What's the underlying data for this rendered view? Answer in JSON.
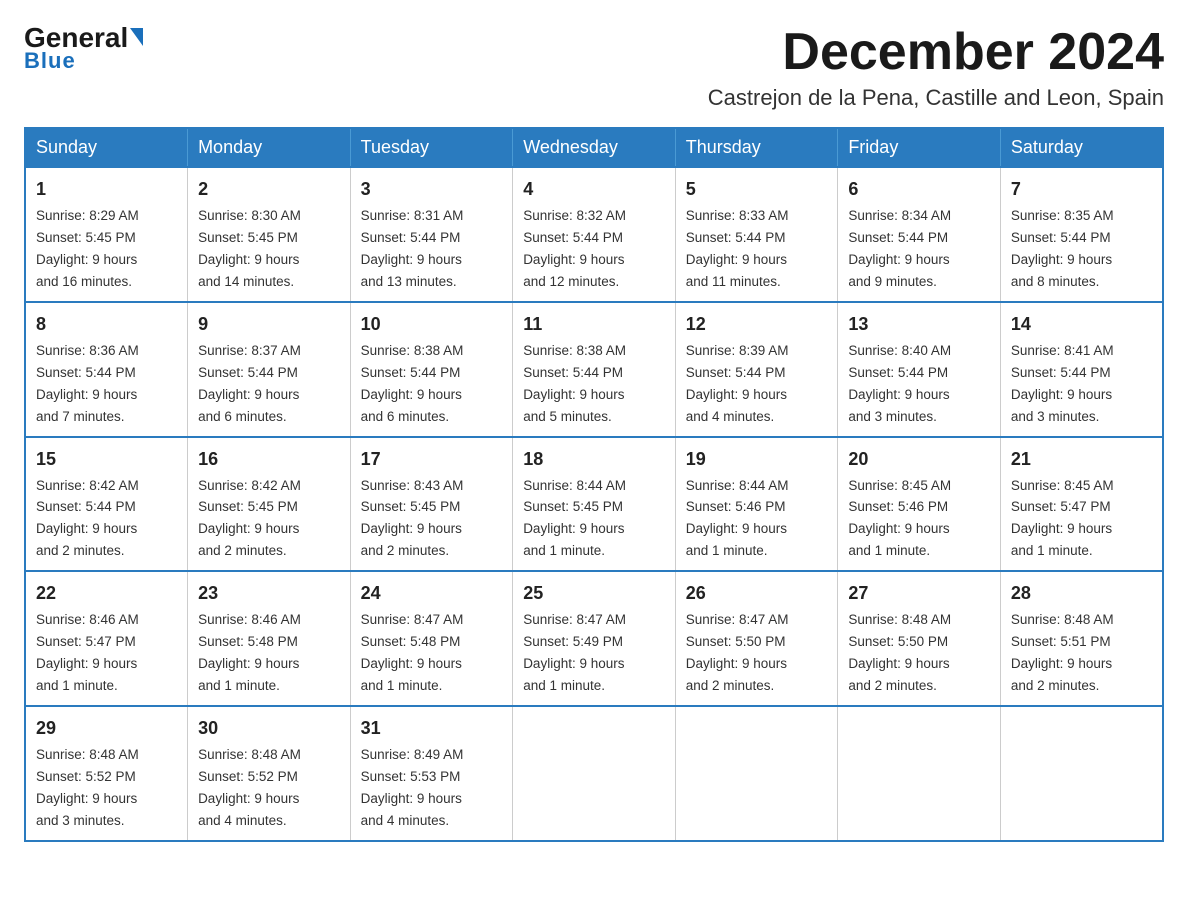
{
  "logo": {
    "general": "General",
    "arrow": "▶",
    "blue": "Blue"
  },
  "header": {
    "month": "December 2024",
    "location": "Castrejon de la Pena, Castille and Leon, Spain"
  },
  "days_of_week": [
    "Sunday",
    "Monday",
    "Tuesday",
    "Wednesday",
    "Thursday",
    "Friday",
    "Saturday"
  ],
  "weeks": [
    [
      {
        "day": "1",
        "sunrise": "8:29 AM",
        "sunset": "5:45 PM",
        "daylight": "9 hours and 16 minutes."
      },
      {
        "day": "2",
        "sunrise": "8:30 AM",
        "sunset": "5:45 PM",
        "daylight": "9 hours and 14 minutes."
      },
      {
        "day": "3",
        "sunrise": "8:31 AM",
        "sunset": "5:44 PM",
        "daylight": "9 hours and 13 minutes."
      },
      {
        "day": "4",
        "sunrise": "8:32 AM",
        "sunset": "5:44 PM",
        "daylight": "9 hours and 12 minutes."
      },
      {
        "day": "5",
        "sunrise": "8:33 AM",
        "sunset": "5:44 PM",
        "daylight": "9 hours and 11 minutes."
      },
      {
        "day": "6",
        "sunrise": "8:34 AM",
        "sunset": "5:44 PM",
        "daylight": "9 hours and 9 minutes."
      },
      {
        "day": "7",
        "sunrise": "8:35 AM",
        "sunset": "5:44 PM",
        "daylight": "9 hours and 8 minutes."
      }
    ],
    [
      {
        "day": "8",
        "sunrise": "8:36 AM",
        "sunset": "5:44 PM",
        "daylight": "9 hours and 7 minutes."
      },
      {
        "day": "9",
        "sunrise": "8:37 AM",
        "sunset": "5:44 PM",
        "daylight": "9 hours and 6 minutes."
      },
      {
        "day": "10",
        "sunrise": "8:38 AM",
        "sunset": "5:44 PM",
        "daylight": "9 hours and 6 minutes."
      },
      {
        "day": "11",
        "sunrise": "8:38 AM",
        "sunset": "5:44 PM",
        "daylight": "9 hours and 5 minutes."
      },
      {
        "day": "12",
        "sunrise": "8:39 AM",
        "sunset": "5:44 PM",
        "daylight": "9 hours and 4 minutes."
      },
      {
        "day": "13",
        "sunrise": "8:40 AM",
        "sunset": "5:44 PM",
        "daylight": "9 hours and 3 minutes."
      },
      {
        "day": "14",
        "sunrise": "8:41 AM",
        "sunset": "5:44 PM",
        "daylight": "9 hours and 3 minutes."
      }
    ],
    [
      {
        "day": "15",
        "sunrise": "8:42 AM",
        "sunset": "5:44 PM",
        "daylight": "9 hours and 2 minutes."
      },
      {
        "day": "16",
        "sunrise": "8:42 AM",
        "sunset": "5:45 PM",
        "daylight": "9 hours and 2 minutes."
      },
      {
        "day": "17",
        "sunrise": "8:43 AM",
        "sunset": "5:45 PM",
        "daylight": "9 hours and 2 minutes."
      },
      {
        "day": "18",
        "sunrise": "8:44 AM",
        "sunset": "5:45 PM",
        "daylight": "9 hours and 1 minute."
      },
      {
        "day": "19",
        "sunrise": "8:44 AM",
        "sunset": "5:46 PM",
        "daylight": "9 hours and 1 minute."
      },
      {
        "day": "20",
        "sunrise": "8:45 AM",
        "sunset": "5:46 PM",
        "daylight": "9 hours and 1 minute."
      },
      {
        "day": "21",
        "sunrise": "8:45 AM",
        "sunset": "5:47 PM",
        "daylight": "9 hours and 1 minute."
      }
    ],
    [
      {
        "day": "22",
        "sunrise": "8:46 AM",
        "sunset": "5:47 PM",
        "daylight": "9 hours and 1 minute."
      },
      {
        "day": "23",
        "sunrise": "8:46 AM",
        "sunset": "5:48 PM",
        "daylight": "9 hours and 1 minute."
      },
      {
        "day": "24",
        "sunrise": "8:47 AM",
        "sunset": "5:48 PM",
        "daylight": "9 hours and 1 minute."
      },
      {
        "day": "25",
        "sunrise": "8:47 AM",
        "sunset": "5:49 PM",
        "daylight": "9 hours and 1 minute."
      },
      {
        "day": "26",
        "sunrise": "8:47 AM",
        "sunset": "5:50 PM",
        "daylight": "9 hours and 2 minutes."
      },
      {
        "day": "27",
        "sunrise": "8:48 AM",
        "sunset": "5:50 PM",
        "daylight": "9 hours and 2 minutes."
      },
      {
        "day": "28",
        "sunrise": "8:48 AM",
        "sunset": "5:51 PM",
        "daylight": "9 hours and 2 minutes."
      }
    ],
    [
      {
        "day": "29",
        "sunrise": "8:48 AM",
        "sunset": "5:52 PM",
        "daylight": "9 hours and 3 minutes."
      },
      {
        "day": "30",
        "sunrise": "8:48 AM",
        "sunset": "5:52 PM",
        "daylight": "9 hours and 4 minutes."
      },
      {
        "day": "31",
        "sunrise": "8:49 AM",
        "sunset": "5:53 PM",
        "daylight": "9 hours and 4 minutes."
      },
      null,
      null,
      null,
      null
    ]
  ],
  "labels": {
    "sunrise": "Sunrise:",
    "sunset": "Sunset:",
    "daylight": "Daylight:"
  }
}
